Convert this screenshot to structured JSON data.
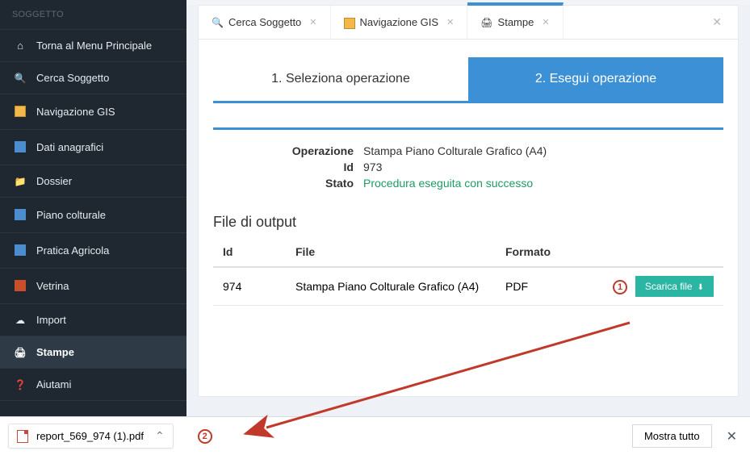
{
  "sidebar": {
    "header": "SOGGETTO",
    "items": [
      {
        "label": "Torna al Menu Principale"
      },
      {
        "label": "Cerca Soggetto"
      },
      {
        "label": "Navigazione GIS"
      },
      {
        "label": "Dati anagrafici"
      },
      {
        "label": "Dossier"
      },
      {
        "label": "Piano colturale"
      },
      {
        "label": "Pratica Agricola"
      },
      {
        "label": "Vetrina"
      },
      {
        "label": "Import"
      },
      {
        "label": "Stampe"
      },
      {
        "label": "Aiutami"
      }
    ]
  },
  "tabs": [
    {
      "label": "Cerca Soggetto"
    },
    {
      "label": "Navigazione GIS"
    },
    {
      "label": "Stampe"
    }
  ],
  "wizard": {
    "step1": "1. Seleziona operazione",
    "step2": "2. Esegui operazione"
  },
  "info": {
    "operation_label": "Operazione",
    "operation_value": "Stampa Piano Colturale Grafico (A4)",
    "id_label": "Id",
    "id_value": "973",
    "state_label": "Stato",
    "state_value": "Procedura eseguita con successo"
  },
  "output_section": {
    "title": "File di output",
    "head_id": "Id",
    "head_file": "File",
    "head_format": "Formato",
    "row": {
      "id": "974",
      "file": "Stampa Piano Colturale Grafico (A4)",
      "format": "PDF",
      "button": "Scarica file"
    }
  },
  "download_bar": {
    "file": "report_569_974 (1).pdf",
    "show_all": "Mostra tutto"
  },
  "annotations": {
    "a1": "1",
    "a2": "2"
  }
}
